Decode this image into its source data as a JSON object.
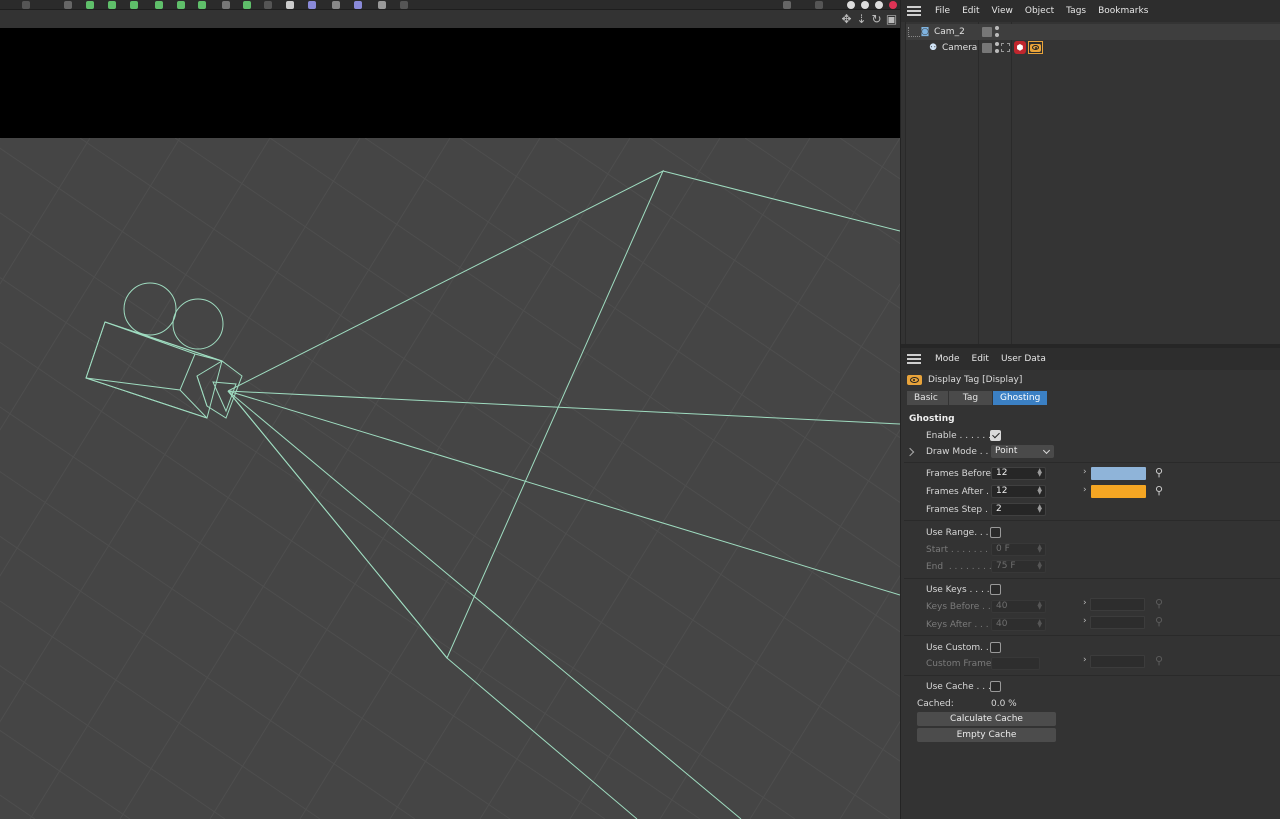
{
  "object_manager": {
    "menu": [
      "File",
      "Edit",
      "View",
      "Object",
      "Tags",
      "Bookmarks"
    ],
    "objects": [
      {
        "name": "Cam_2",
        "selected": true
      },
      {
        "name": "Camera",
        "selected": false
      }
    ]
  },
  "attribute_manager": {
    "menu": [
      "Mode",
      "Edit",
      "User Data"
    ],
    "tag_title": "Display Tag [Display]",
    "tabs": [
      "Basic",
      "Tag",
      "Ghosting"
    ],
    "active_tab": "Ghosting",
    "section": "Ghosting",
    "enable_label": "Enable . . . . . .",
    "enable_checked": true,
    "draw_mode_label": "Draw Mode . . .",
    "draw_mode_value": "Point",
    "frames_before_label": "Frames Before",
    "frames_before_value": "12",
    "frames_before_color": "#8fb4d9",
    "frames_after_label": "Frames After . .",
    "frames_after_value": "12",
    "frames_after_color": "#f5a623",
    "frames_step_label": "Frames Step . .",
    "frames_step_value": "2",
    "use_range_label": "Use Range. . . .",
    "start_label": "Start . . . . . . . . .",
    "start_value": "0 F",
    "end_label": "End  . . . . . . . . .",
    "end_value": "75 F",
    "use_keys_label": "Use Keys . . . . .",
    "keys_before_label": "Keys Before . . .",
    "keys_before_value": "40",
    "keys_after_label": "Keys After . . . .",
    "keys_after_value": "40",
    "use_custom_label": "Use Custom. . . .",
    "custom_frames_label": "Custom Frames",
    "use_cache_label": "Use Cache . . . .",
    "cached_label": "Cached:",
    "cached_value": "0.0 %",
    "calculate_cache": "Calculate Cache",
    "empty_cache": "Empty Cache"
  },
  "colors": {
    "wireframe": "#9fdcc0",
    "viewport_bg": "#454545",
    "accent_tab": "#3b80c4",
    "tag_icon": "#e8a33a"
  }
}
